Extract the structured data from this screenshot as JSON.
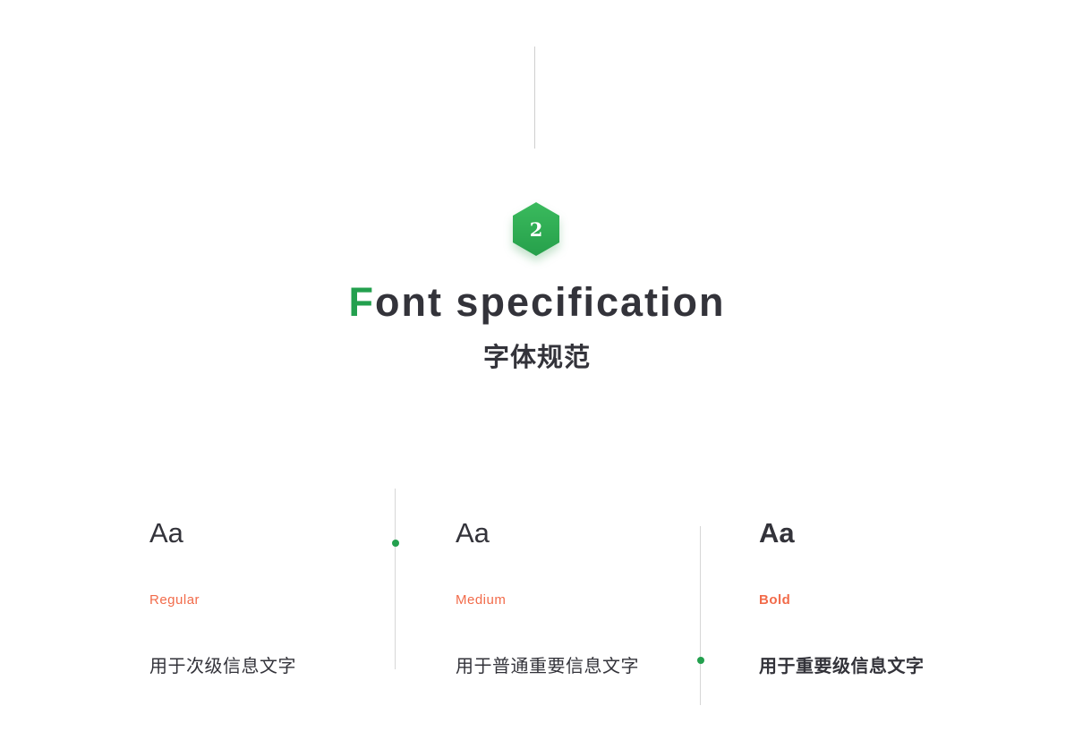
{
  "section": {
    "number": "2",
    "title_first_letter": "F",
    "title_rest": "ont specification",
    "subtitle": "字体规范"
  },
  "columns": [
    {
      "sample": "Aa",
      "weight_label": "Regular",
      "usage": "用于次级信息文字"
    },
    {
      "sample": "Aa",
      "weight_label": "Medium",
      "usage": "用于普通重要信息文字"
    },
    {
      "sample": "Aa",
      "weight_label": "Bold",
      "usage": "用于重要级信息文字"
    }
  ],
  "colors": {
    "accent_green": "#23a04e",
    "label_orange": "#f26b4a",
    "text_dark": "#33333a",
    "line_gray": "#d6d6d6"
  }
}
